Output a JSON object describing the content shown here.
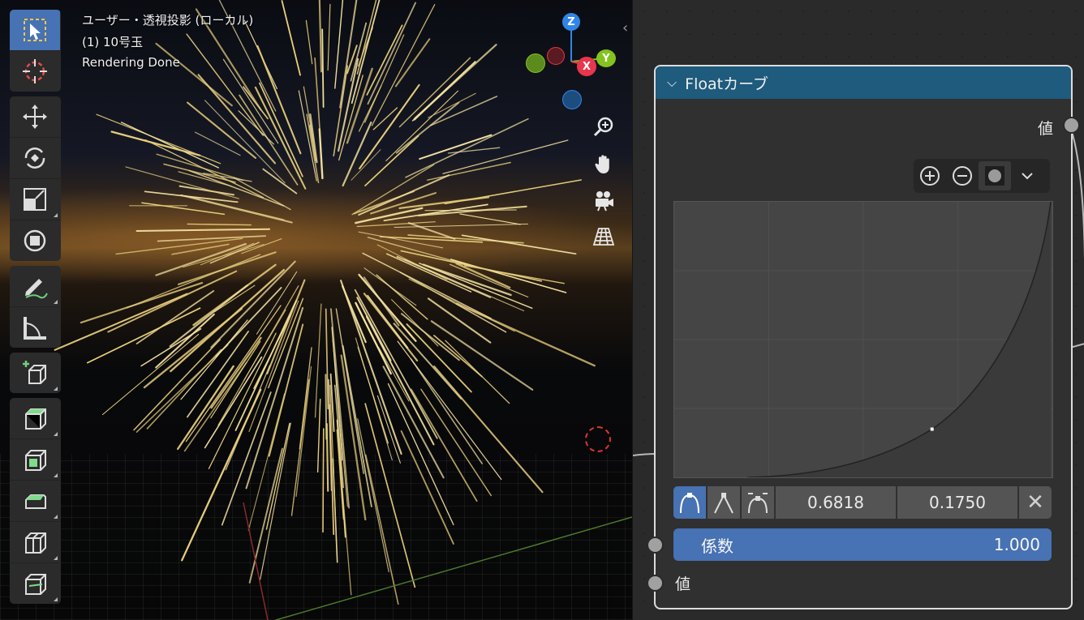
{
  "viewport": {
    "view_name": "ユーザー・透視投影 (ローカル)",
    "object_name": "(1) 10号玉",
    "status": "Rendering Done",
    "toolbar": [
      "select-box",
      "cursor",
      "move",
      "rotate",
      "scale",
      "transform",
      "annotate",
      "measure",
      "add-cube",
      "extrude-region",
      "inset-faces",
      "bevel",
      "loop-cut",
      "knife"
    ],
    "gizmo": {
      "z": "Z",
      "x": "X",
      "y": "Y"
    },
    "nav_icons": [
      "zoom-icon",
      "pan-hand-icon",
      "camera-icon",
      "perspective-grid-icon"
    ]
  },
  "node": {
    "title": "Floatカーブ",
    "output_label": "値",
    "input_label": "値",
    "curve_tools": [
      "zoom-in-icon",
      "zoom-out-icon",
      "clip-icon",
      "dropdown-icon"
    ],
    "selected_point": {
      "x": "0.6818",
      "y": "0.1750"
    },
    "factor_label": "係数",
    "factor_value": "1.000",
    "curve_points": [
      [
        0,
        0
      ],
      [
        0.6818,
        0.175
      ],
      [
        1,
        1
      ]
    ]
  },
  "colors": {
    "header": "#1e5b7d",
    "accent": "#4772b3",
    "gizmo_x": "#e8364e",
    "gizmo_y": "#84c21e",
    "gizmo_z": "#2f86e8"
  }
}
